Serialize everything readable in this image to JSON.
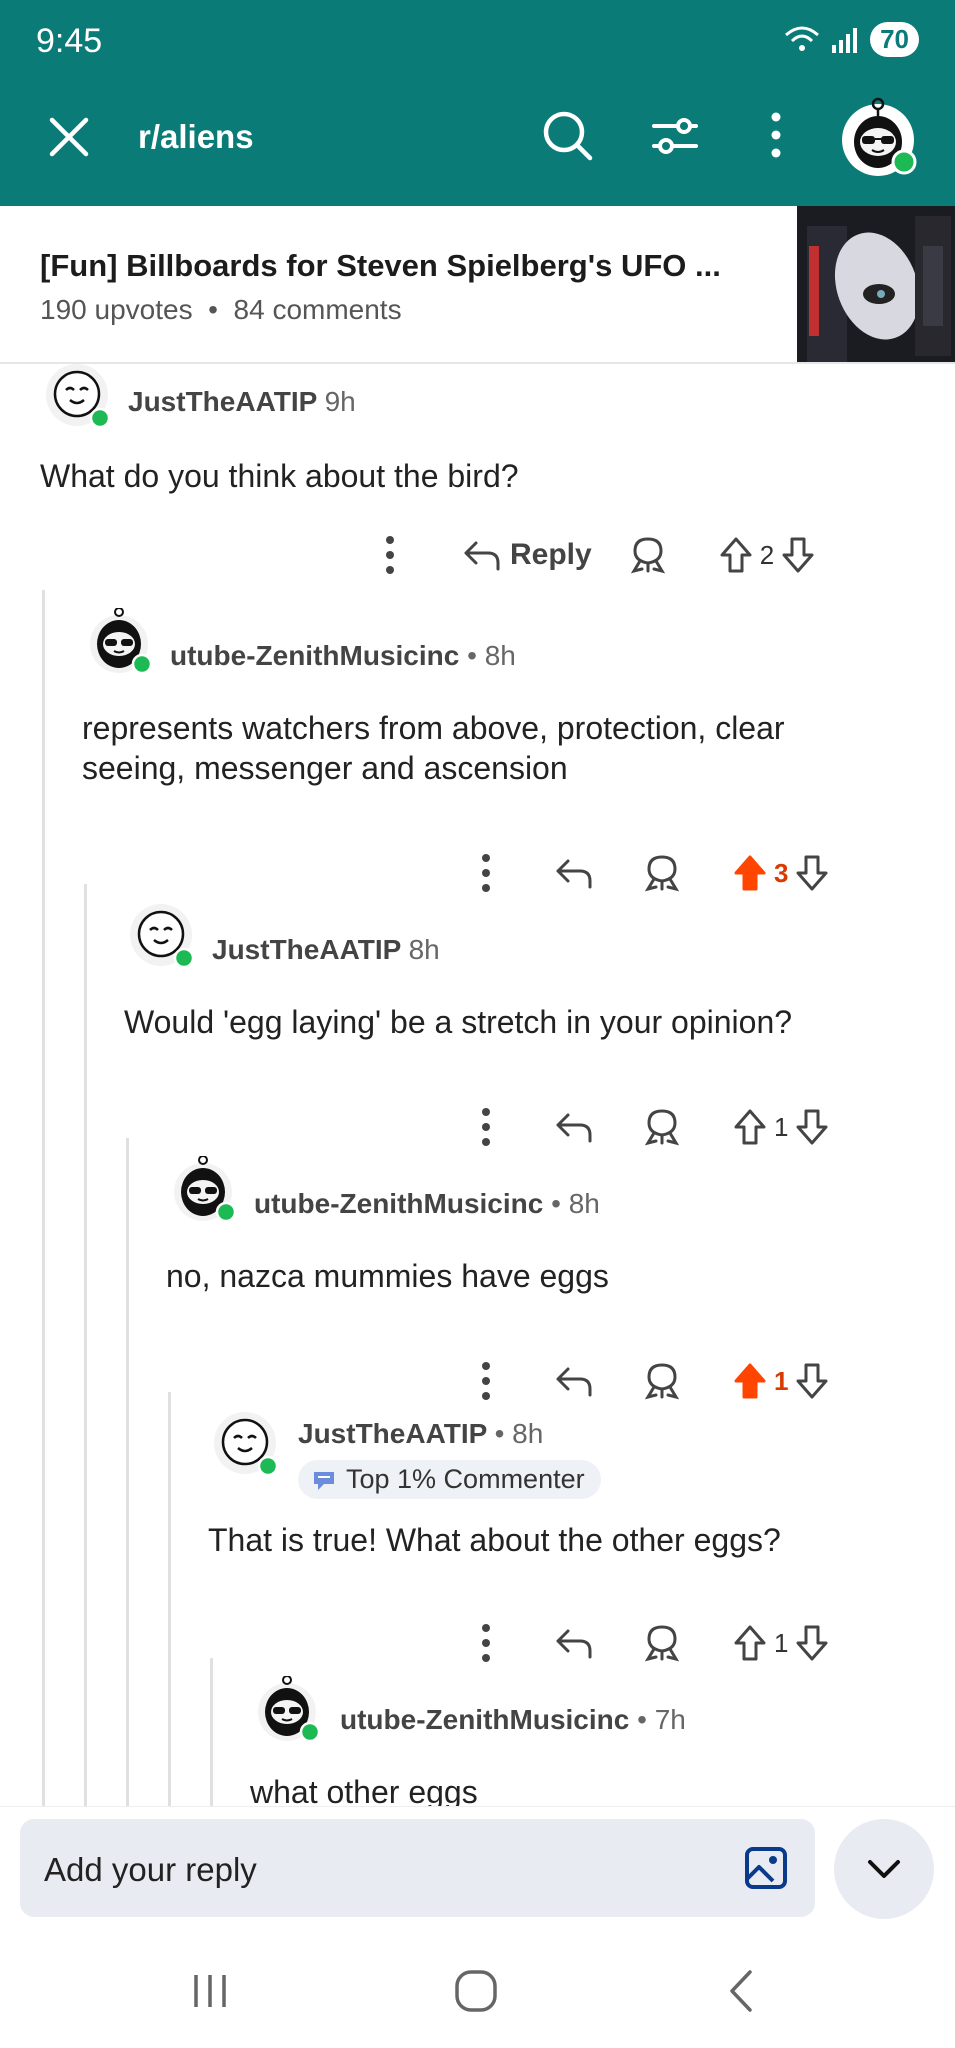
{
  "status": {
    "time": "9:45",
    "battery": "70"
  },
  "header": {
    "subreddit": "r/aliens"
  },
  "post": {
    "title": "[Fun] Billboards for Steven Spielberg's UFO ...",
    "upvotes": "190 upvotes",
    "separator": "•",
    "comments": "84 comments"
  },
  "comments": [
    {
      "author": "JustTheAATIP",
      "time": "9h",
      "body": "What do you think about the bird?",
      "reply_label": "Reply",
      "votes": "2",
      "upvoted": false
    },
    {
      "author": "utube-ZenithMusicinc",
      "time": "• 8h",
      "body": "represents watchers from above, protection, clear seeing, messenger and ascension",
      "votes": "3",
      "upvoted": true
    },
    {
      "author": "JustTheAATIP",
      "time": "8h",
      "body": "Would 'egg laying' be a stretch in your opinion?",
      "votes": "1",
      "upvoted": false
    },
    {
      "author": "utube-ZenithMusicinc",
      "time": "• 8h",
      "body": "no, nazca mummies have eggs",
      "votes": "1",
      "upvoted": true
    },
    {
      "author": "JustTheAATIP",
      "time": "• 8h",
      "badge": "Top 1% Commenter",
      "body": "That is true! What about the other eggs?",
      "votes": "1",
      "upvoted": false
    },
    {
      "author": "utube-ZenithMusicinc",
      "time": "• 7h",
      "body": "what other eggs"
    }
  ],
  "reply_bar": {
    "placeholder": "Add your reply"
  },
  "colors": {
    "header_bg": "#0b7b78",
    "upvote": "#d93a00",
    "online": "#1db954"
  }
}
